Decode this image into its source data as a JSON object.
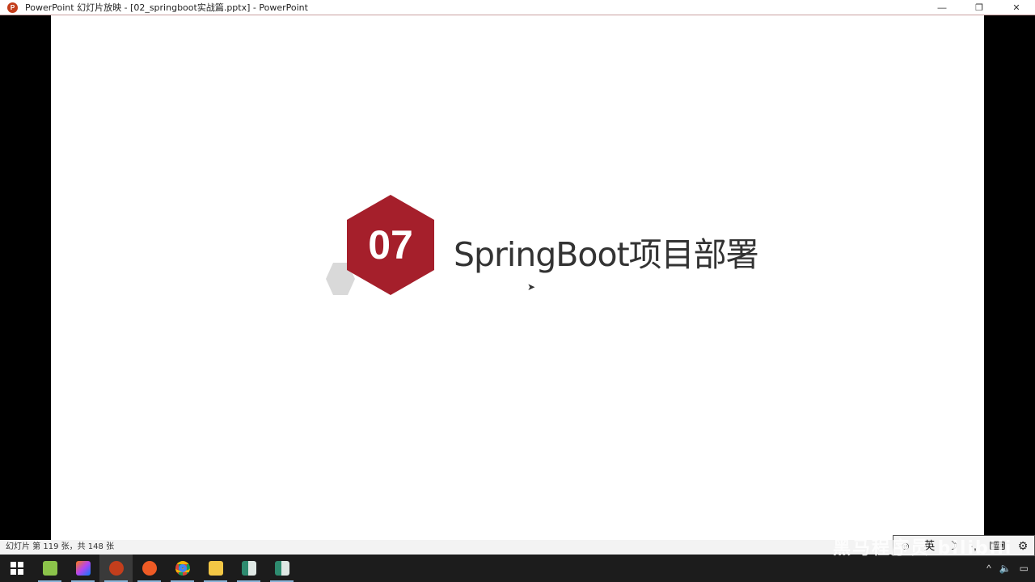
{
  "window": {
    "title": "PowerPoint 幻灯片放映 - [02_springboot实战篇.pptx] - PowerPoint",
    "app_icon": "P",
    "minimize": "—",
    "restore": "❐",
    "close": "✕"
  },
  "slide": {
    "number_badge": "07",
    "title": "SpringBoot项目部署",
    "accent_color": "#a51f2b"
  },
  "status": {
    "text": "幻灯片 第 119 张，共 148 张"
  },
  "ime": {
    "mode": "英",
    "moon": "☽",
    "dots": "·,",
    "keyboard": "⌨",
    "settings": "⚙"
  },
  "watermark": "黑马程序员 bilibili",
  "taskbar": {
    "apps": [
      "start",
      "notepad++",
      "intellij-idea",
      "powerpoint",
      "postman",
      "chrome",
      "file-explorer",
      "app-window-1",
      "app-window-2"
    ]
  },
  "tray": {
    "chevron": "^",
    "volume": "🔈",
    "network": "▭"
  }
}
